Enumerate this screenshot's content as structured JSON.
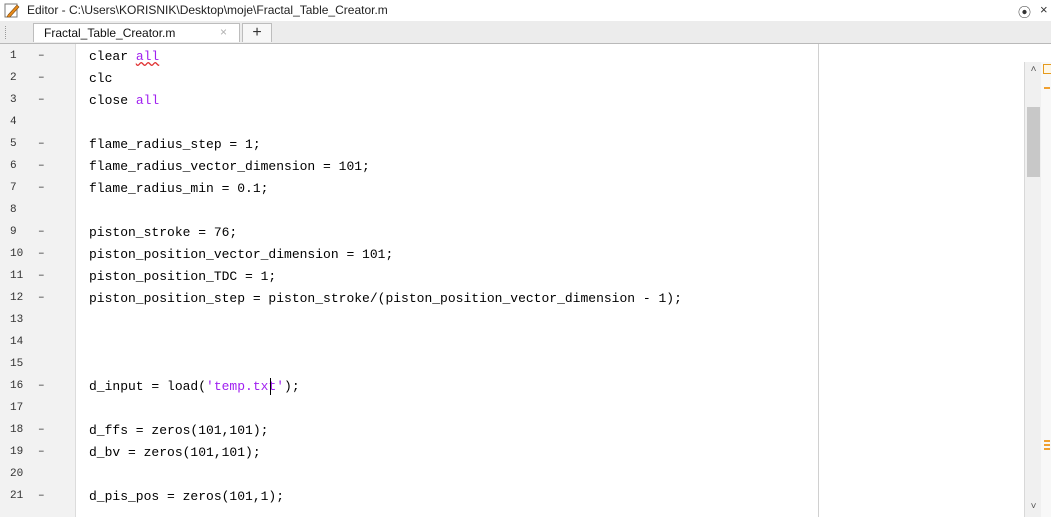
{
  "window": {
    "title": "Editor - C:\\Users\\KORISNIK\\Desktop\\moje\\Fractal_Table_Creator.m",
    "title_icon": "pencil-edit-icon",
    "menu_glyph": "⦿",
    "close_glyph": "×"
  },
  "tabs": [
    {
      "label": "Fractal_Table_Creator.m",
      "close_glyph": "×",
      "active": true
    }
  ],
  "add_tab_label": "+",
  "editor": {
    "lines": [
      {
        "num": "1",
        "bp": "–",
        "code": "clear all"
      },
      {
        "num": "2",
        "bp": "–",
        "code": "clc"
      },
      {
        "num": "3",
        "bp": "–",
        "code": "close all"
      },
      {
        "num": "4",
        "bp": "",
        "code": ""
      },
      {
        "num": "5",
        "bp": "–",
        "code": "flame_radius_step = 1;"
      },
      {
        "num": "6",
        "bp": "–",
        "code": "flame_radius_vector_dimension = 101;"
      },
      {
        "num": "7",
        "bp": "–",
        "code": "flame_radius_min = 0.1;"
      },
      {
        "num": "8",
        "bp": "",
        "code": ""
      },
      {
        "num": "9",
        "bp": "–",
        "code": "piston_stroke = 76;"
      },
      {
        "num": "10",
        "bp": "–",
        "code": "piston_position_vector_dimension = 101;"
      },
      {
        "num": "11",
        "bp": "–",
        "code": "piston_position_TDC = 1;"
      },
      {
        "num": "12",
        "bp": "–",
        "code": "piston_position_step = piston_stroke/(piston_position_vector_dimension - 1);"
      },
      {
        "num": "13",
        "bp": "",
        "code": ""
      },
      {
        "num": "14",
        "bp": "",
        "code": ""
      },
      {
        "num": "15",
        "bp": "",
        "code": ""
      },
      {
        "num": "16",
        "bp": "–",
        "code": "d_input = load('temp.txt');"
      },
      {
        "num": "17",
        "bp": "",
        "code": ""
      },
      {
        "num": "18",
        "bp": "–",
        "code": "d_ffs = zeros(101,101);"
      },
      {
        "num": "19",
        "bp": "–",
        "code": "d_bv = zeros(101,101);"
      },
      {
        "num": "20",
        "bp": "",
        "code": ""
      },
      {
        "num": "21",
        "bp": "–",
        "code": "d_pis_pos = zeros(101,1);"
      }
    ]
  },
  "scrollbar": {
    "up_glyph": "˄",
    "down_glyph": "˅"
  },
  "colors": {
    "keyword": "#a020f0",
    "string": "#a020f0",
    "warning": "#f0a030"
  }
}
